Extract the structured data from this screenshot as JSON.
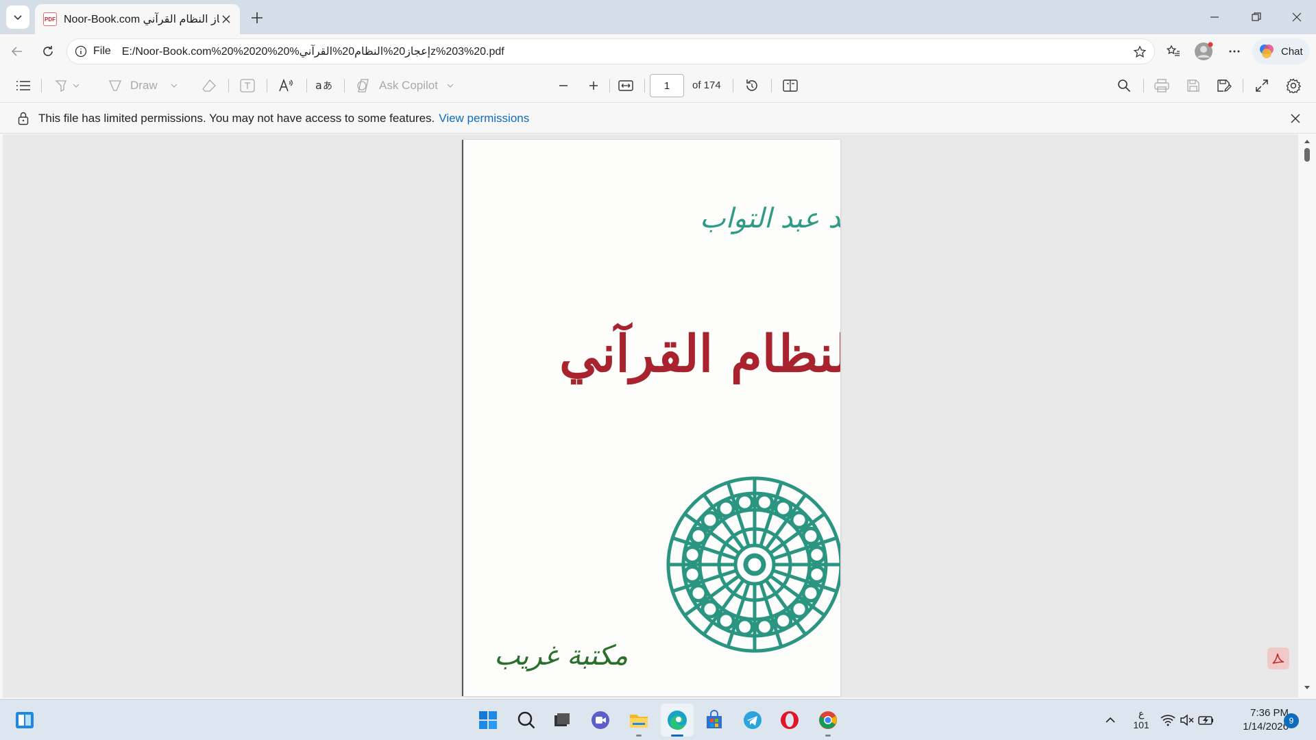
{
  "browser": {
    "tab": {
      "title": "Noor-Book.com إعجاز النظام القرآني",
      "favicon": "PDF"
    },
    "address": {
      "scheme": "File",
      "url": "E:/Noor-Book.com%20%2020%إعجاز20%النظام20%القرآني%20z%203%20.pdf"
    },
    "chat_label": "Chat"
  },
  "pdf_toolbar": {
    "draw_label": "Draw",
    "ask_copilot_label": "Ask Copilot",
    "page_number": "1",
    "page_total": "of 174"
  },
  "infobar": {
    "message": "This file has limited permissions. You may not have access to some features.",
    "link": "View permissions"
  },
  "document": {
    "author": "لواء أحمد عبد التواب",
    "title": "إعجاز النظام القرآني",
    "publisher": "مكتبة غريب"
  },
  "taskbar": {
    "keyboard_lang": "ع",
    "keyboard_sub": "101",
    "time": "7:36 PM",
    "date": "1/14/2026",
    "notifications": "9"
  },
  "colors": {
    "title_red": "#a8232d",
    "ornament_teal": "#2a9580",
    "accent_blue": "#0f6cbd"
  }
}
